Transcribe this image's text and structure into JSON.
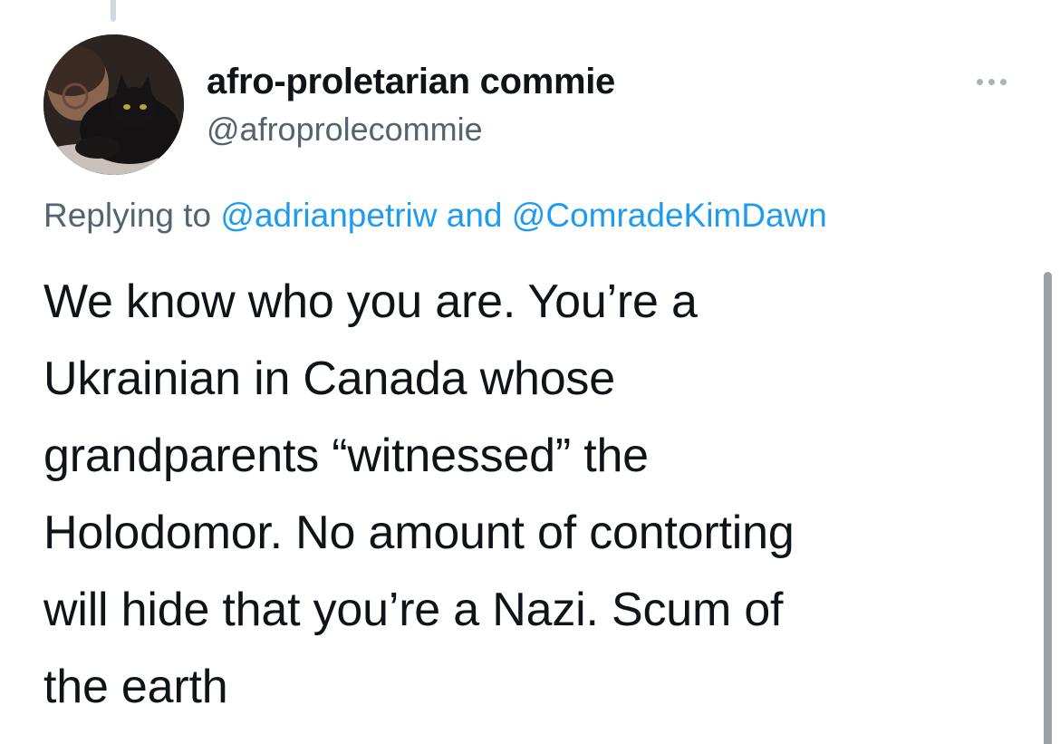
{
  "tweet": {
    "author": {
      "display_name": "afro-proletarian commie",
      "handle": "@afroprolecommie",
      "avatar_icon": "profile-photo-person-with-black-cat"
    },
    "more_icon": "ellipsis-icon",
    "reply_context": {
      "prefix": "Replying to ",
      "mention_1": "@adrianpetriw",
      "joiner": " and ",
      "mention_2": "@ComradeKimDawn"
    },
    "text_lines": [
      "We know who you are. You’re a",
      "Ukrainian in Canada whose",
      "grandparents “witnessed” the",
      "Holodomor. No amount of contorting",
      "will hide that you’re a Nazi. Scum of",
      "the earth"
    ]
  },
  "colors": {
    "text_primary": "#0f1419",
    "text_secondary": "#536471",
    "link": "#1d9bf0",
    "thread_line": "#cfd9de"
  }
}
